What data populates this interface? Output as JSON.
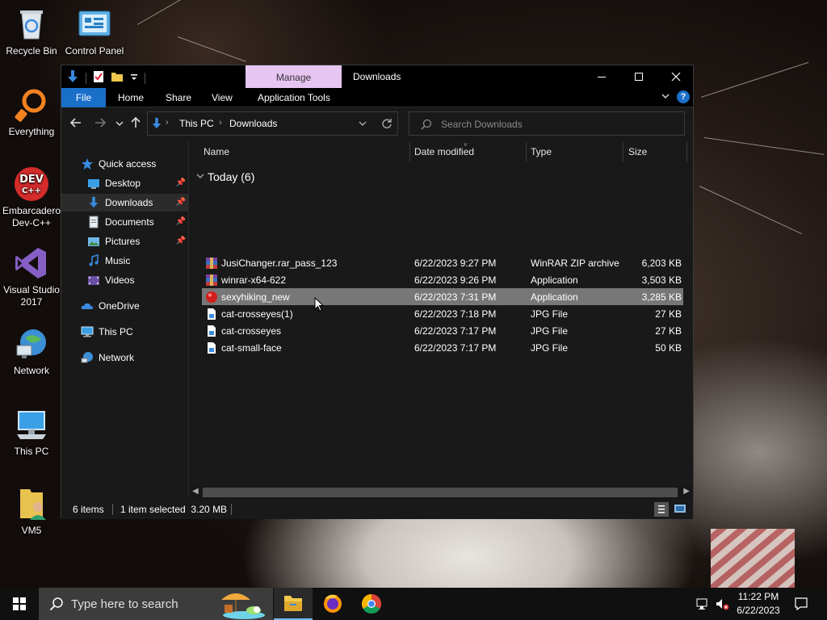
{
  "desktop": {
    "icons": [
      {
        "label": "Recycle Bin",
        "icon": "recycle-bin-icon"
      },
      {
        "label": "Control Panel",
        "icon": "control-panel-icon"
      },
      {
        "label": "Everything",
        "icon": "everything-icon"
      },
      {
        "label": "Embarcadero Dev-C++",
        "icon": "devcpp-icon",
        "glyph_text": "DEV C++"
      },
      {
        "label": "Visual Studio 2017",
        "icon": "visual-studio-icon"
      },
      {
        "label": "Network",
        "icon": "network-icon"
      },
      {
        "label": "This PC",
        "icon": "this-pc-icon"
      },
      {
        "label": "VM5",
        "icon": "folder-user-icon"
      }
    ]
  },
  "explorer": {
    "manage_tab": "Manage",
    "window_title": "Downloads",
    "controls": {
      "minimize": "—",
      "maximize": "☐",
      "close": "✕"
    },
    "ribbon_tabs": [
      "File",
      "Home",
      "Share",
      "View",
      "Application Tools"
    ],
    "address": {
      "segments": [
        "This PC",
        "Downloads"
      ]
    },
    "search_placeholder": "Search Downloads",
    "nav": [
      {
        "label": "Quick access",
        "icon": "star-icon",
        "pinned": false
      },
      {
        "label": "Desktop",
        "icon": "desktop-folder-icon",
        "pinned": true
      },
      {
        "label": "Downloads",
        "icon": "downloads-folder-icon",
        "pinned": true,
        "selected": true
      },
      {
        "label": "Documents",
        "icon": "documents-folder-icon",
        "pinned": true
      },
      {
        "label": "Pictures",
        "icon": "pictures-folder-icon",
        "pinned": true
      },
      {
        "label": "Music",
        "icon": "music-folder-icon",
        "pinned": false
      },
      {
        "label": "Videos",
        "icon": "videos-folder-icon",
        "pinned": false
      },
      {
        "label": "OneDrive",
        "icon": "onedrive-icon",
        "pinned": false
      },
      {
        "label": "This PC",
        "icon": "this-pc-icon",
        "pinned": false
      },
      {
        "label": "Network",
        "icon": "network-icon",
        "pinned": false
      }
    ],
    "columns": [
      "Name",
      "Date modified",
      "Type",
      "Size"
    ],
    "group_title": "Today (6)",
    "files": [
      {
        "name": "JusiChanger.rar_pass_123",
        "date": "6/22/2023 9:27 PM",
        "type": "WinRAR ZIP archive",
        "size": "6,203 KB",
        "icon": "winrar-archive-icon"
      },
      {
        "name": "winrar-x64-622",
        "date": "6/22/2023 9:26 PM",
        "type": "Application",
        "size": "3,503 KB",
        "icon": "winrar-app-icon"
      },
      {
        "name": "sexyhiking_new",
        "date": "6/22/2023 7:31 PM",
        "type": "Application",
        "size": "3,285 KB",
        "icon": "red-ball-app-icon",
        "selected": true
      },
      {
        "name": "cat-crosseyes(1)",
        "date": "6/22/2023 7:18 PM",
        "type": "JPG File",
        "size": "27 KB",
        "icon": "jpg-file-icon"
      },
      {
        "name": "cat-crosseyes",
        "date": "6/22/2023 7:17 PM",
        "type": "JPG File",
        "size": "27 KB",
        "icon": "jpg-file-icon"
      },
      {
        "name": "cat-small-face",
        "date": "6/22/2023 7:17 PM",
        "type": "JPG File",
        "size": "50 KB",
        "icon": "jpg-file-icon"
      }
    ],
    "status": {
      "items": "6 items",
      "selected": "1 item selected  3.20 MB"
    }
  },
  "taskbar": {
    "search_placeholder": "Type here to search",
    "apps": [
      "file-explorer-icon",
      "firefox-icon",
      "chrome-icon"
    ],
    "time": "11:22 PM",
    "date": "6/22/2023"
  },
  "colors": {
    "accent": "#1a6fc9",
    "manage_tab": "#e7c5f2",
    "selection_row": "#777777",
    "window_bg": "#191919"
  }
}
